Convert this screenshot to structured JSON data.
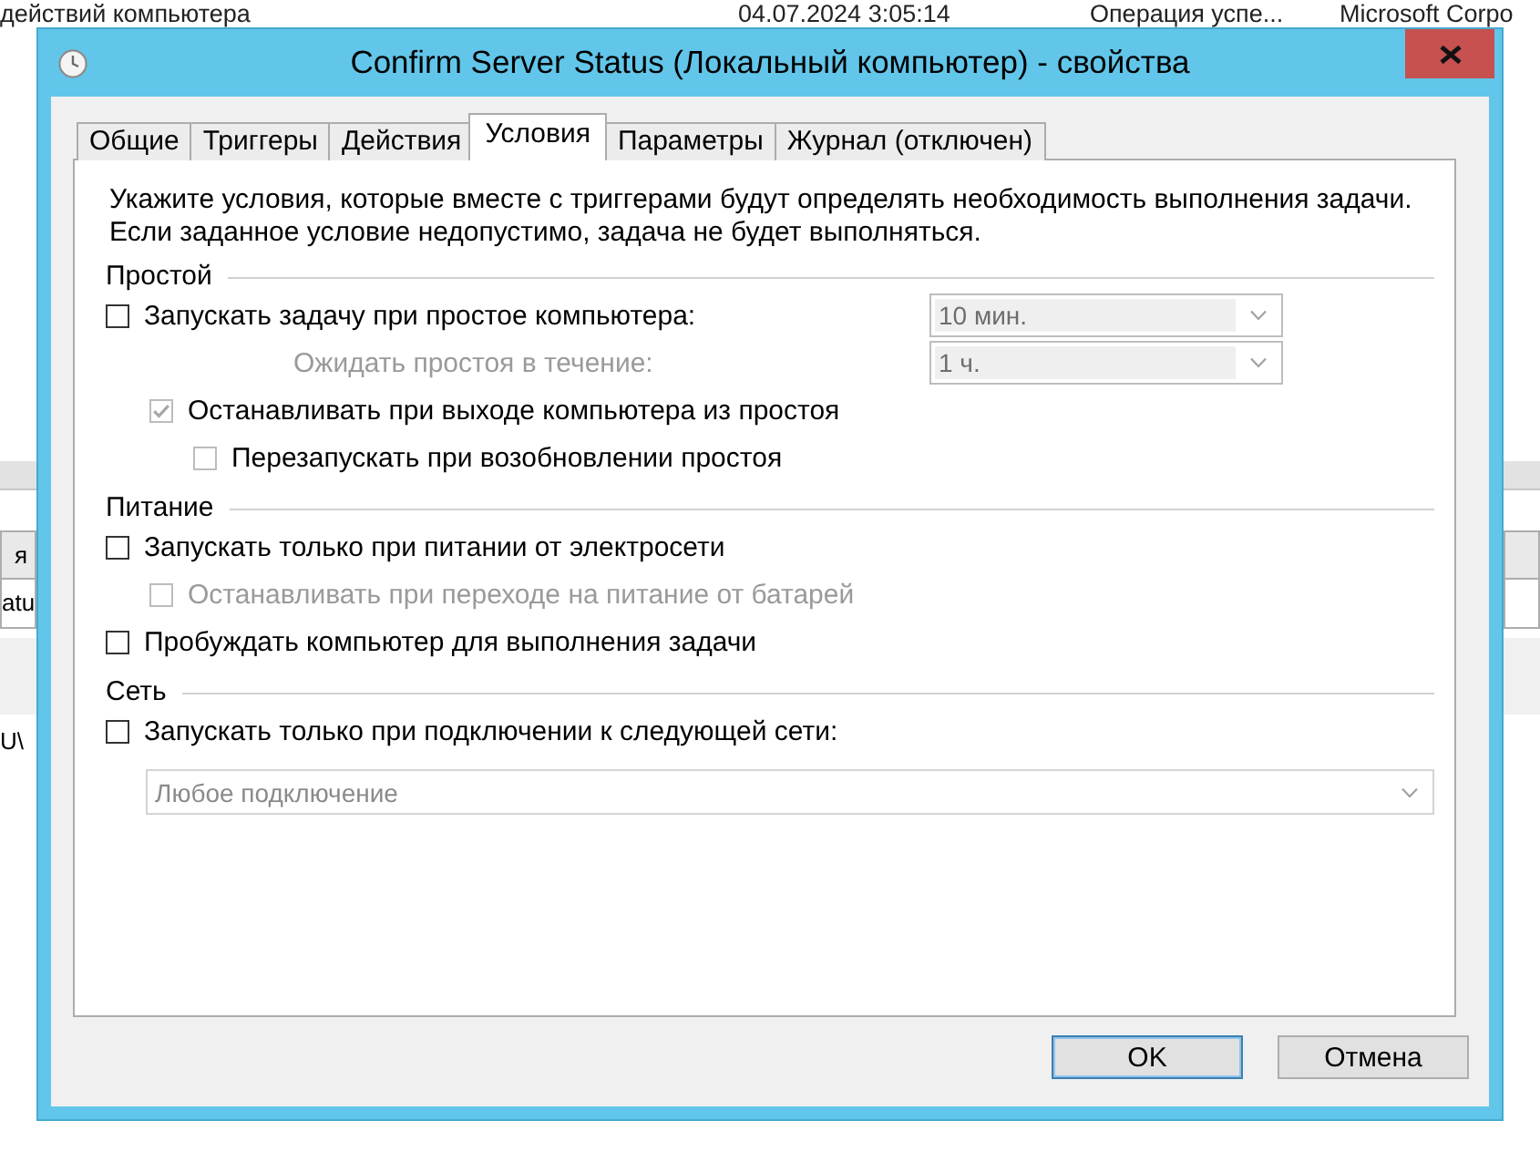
{
  "background_app": {
    "top_row": [
      "действий компьютера",
      "04.07.2024 3:05:14",
      "Операция успе...",
      "Microsoft Corpo"
    ],
    "left_edge": [
      {
        "kind": "tab",
        "text": "я"
      },
      {
        "kind": "cell",
        "text": "atu"
      },
      {
        "kind": "text",
        "text": "U\\"
      }
    ]
  },
  "window": {
    "title": "Confirm Server Status (Локальный компьютер) - свойства"
  },
  "tabs": [
    {
      "label": "Общие",
      "selected": false
    },
    {
      "label": "Триггеры",
      "selected": false
    },
    {
      "label": "Действия",
      "selected": false
    },
    {
      "label": "Условия",
      "selected": true
    },
    {
      "label": "Параметры",
      "selected": false
    },
    {
      "label": "Журнал (отключен)",
      "selected": false
    }
  ],
  "intro": [
    "Укажите условия, которые вместе с триггерами будут определять необходимость выполнения задачи.",
    "Если заданное условие недопустимо, задача не будет выполняться."
  ],
  "sections": [
    {
      "title": "Простой",
      "items": [
        {
          "kind": "checkbox-dropdown",
          "label": "Запускать задачу при простое компьютера:",
          "checked": false,
          "disabled": false,
          "label_disabled": false,
          "dropdown": {
            "value": "10 мин.",
            "disabled": true
          },
          "children": [
            {
              "kind": "label-dropdown",
              "label": "Ожидать простоя в течение:",
              "label_disabled": true,
              "dropdown": {
                "value": "1 ч.",
                "disabled": true
              }
            },
            {
              "kind": "checkbox",
              "label": "Останавливать при выходе компьютера из простоя",
              "checked": true,
              "disabled": true,
              "label_disabled": false,
              "children": [
                {
                  "kind": "checkbox",
                  "label": "Перезапускать при возобновлении простоя",
                  "checked": false,
                  "disabled": true,
                  "label_disabled": false
                }
              ]
            }
          ]
        }
      ]
    },
    {
      "title": "Питание",
      "items": [
        {
          "kind": "checkbox",
          "label": "Запускать только при питании от электросети",
          "checked": false,
          "disabled": false,
          "label_disabled": false,
          "children": [
            {
              "kind": "checkbox",
              "label": "Останавливать при переходе на питание от батарей",
              "checked": false,
              "disabled": true,
              "label_disabled": true
            }
          ]
        },
        {
          "kind": "checkbox",
          "label": "Пробуждать компьютер для выполнения задачи",
          "checked": false,
          "disabled": false,
          "label_disabled": false
        }
      ]
    },
    {
      "title": "Сеть",
      "items": [
        {
          "kind": "checkbox",
          "label": "Запускать только при подключении к следующей сети:",
          "checked": false,
          "disabled": false,
          "label_disabled": false,
          "children": [
            {
              "kind": "dropdown",
              "dropdown": {
                "value": "Любое подключение",
                "disabled": true
              }
            }
          ]
        }
      ]
    }
  ],
  "buttons": [
    {
      "label": "OK",
      "default": true
    },
    {
      "label": "Отмена",
      "default": false
    }
  ]
}
